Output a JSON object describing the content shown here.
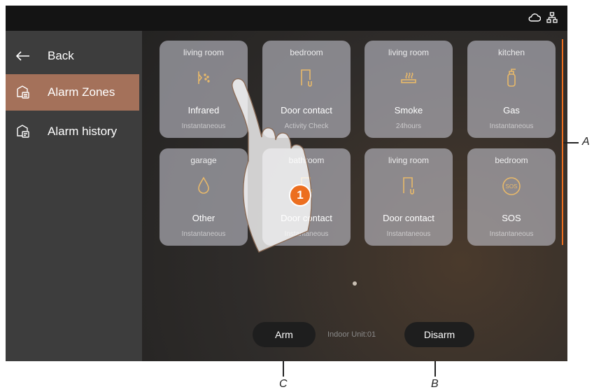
{
  "sidebar": {
    "items": [
      {
        "label": "Back",
        "icon": "arrow-left-icon"
      },
      {
        "label": "Alarm Zones",
        "icon": "alarm-zones-icon",
        "active": true
      },
      {
        "label": "Alarm history",
        "icon": "alarm-history-icon"
      }
    ]
  },
  "zones": [
    {
      "room": "living room",
      "type": "Infrared",
      "mode": "Instantaneous",
      "icon": "infrared-sensor-icon"
    },
    {
      "room": "bedroom",
      "type": "Door contact",
      "mode": "Activity Check",
      "icon": "door-contact-icon"
    },
    {
      "room": "living room",
      "type": "Smoke",
      "mode": "24hours",
      "icon": "smoke-detector-icon"
    },
    {
      "room": "kitchen",
      "type": "Gas",
      "mode": "Instantaneous",
      "icon": "gas-cylinder-icon"
    },
    {
      "room": "garage",
      "type": "Other",
      "mode": "Instantaneous",
      "icon": "water-drop-icon"
    },
    {
      "room": "bathroom",
      "type": "Door contact",
      "mode": "Instantaneous",
      "icon": "door-contact-icon"
    },
    {
      "room": "living room",
      "type": "Door contact",
      "mode": "Instantaneous",
      "icon": "door-contact-icon"
    },
    {
      "room": "bedroom",
      "type": "SOS",
      "mode": "Instantaneous",
      "icon": "sos-icon"
    }
  ],
  "footer": {
    "arm_label": "Arm",
    "indoor_unit": "Indoor Unit:01",
    "disarm_label": "Disarm"
  },
  "callouts": {
    "step": "1",
    "a": "A",
    "b": "B",
    "c": "C"
  },
  "colors": {
    "accent": "#a4715a",
    "badge": "#ec6e1f",
    "icon": "#e8b96a"
  }
}
